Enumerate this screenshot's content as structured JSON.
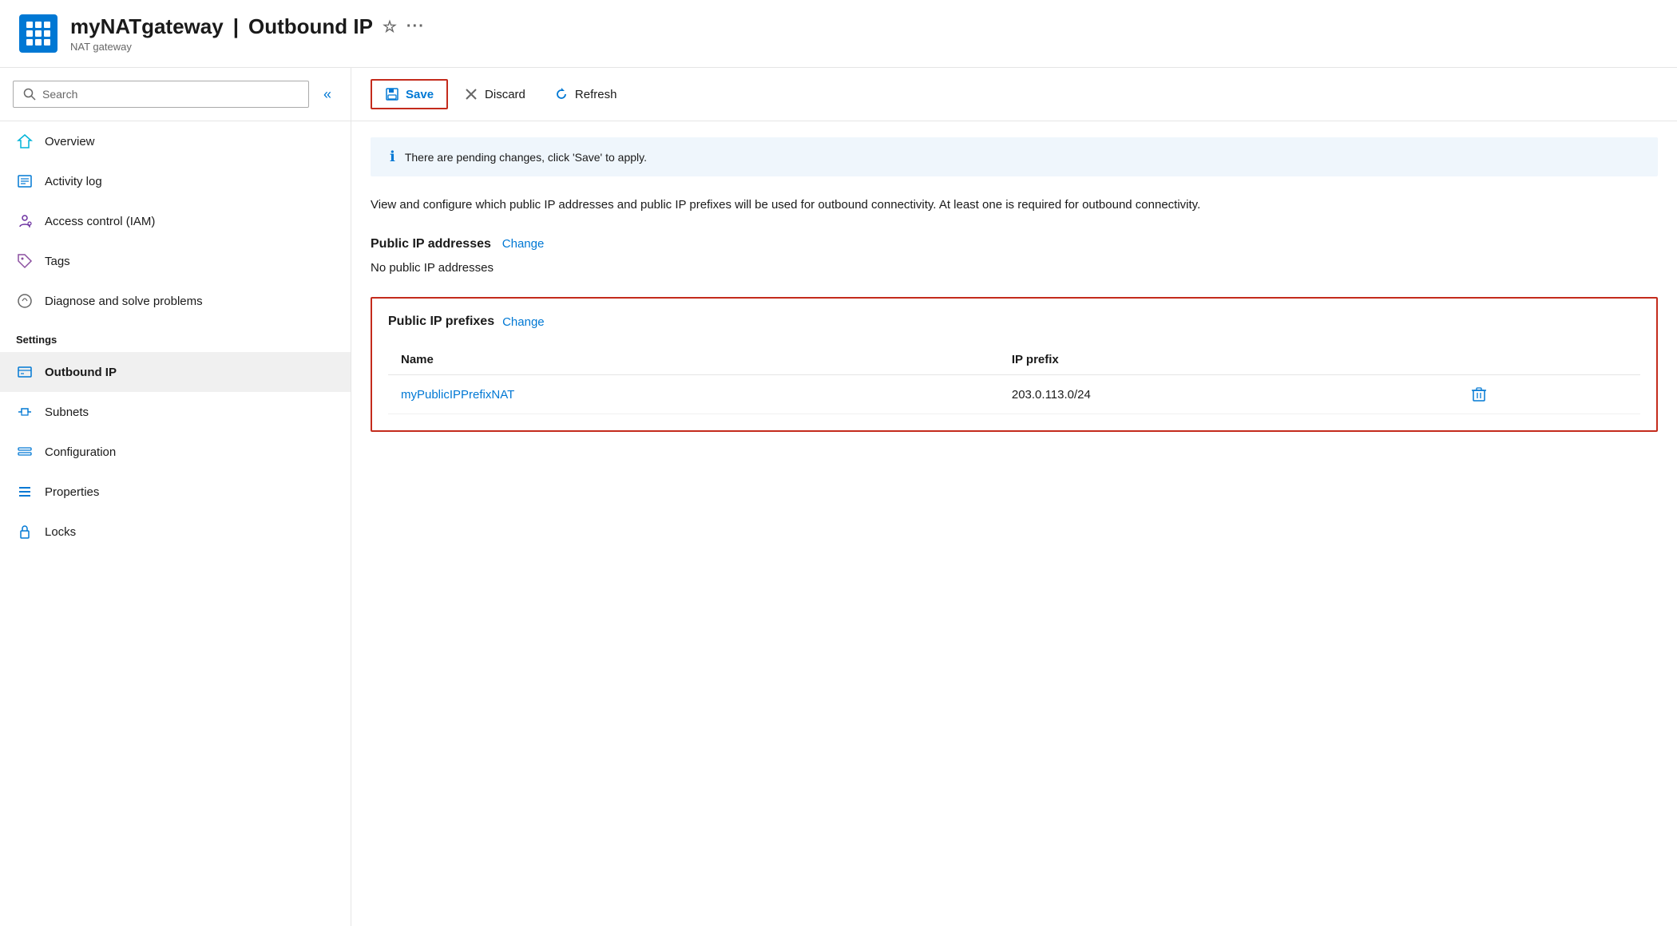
{
  "header": {
    "icon_label": "NAT gateway icon",
    "title_prefix": "myNATgateway",
    "title_separator": "|",
    "title_section": "Outbound IP",
    "subtitle": "NAT gateway"
  },
  "sidebar": {
    "search_placeholder": "Search",
    "collapse_label": "«",
    "nav_items": [
      {
        "id": "overview",
        "label": "Overview",
        "icon": "overview"
      },
      {
        "id": "activity-log",
        "label": "Activity log",
        "icon": "activity"
      },
      {
        "id": "access-control",
        "label": "Access control (IAM)",
        "icon": "iam"
      },
      {
        "id": "tags",
        "label": "Tags",
        "icon": "tags"
      },
      {
        "id": "diagnose",
        "label": "Diagnose and solve problems",
        "icon": "diagnose"
      }
    ],
    "settings_label": "Settings",
    "settings_items": [
      {
        "id": "outbound-ip",
        "label": "Outbound IP",
        "icon": "outbound",
        "active": true
      },
      {
        "id": "subnets",
        "label": "Subnets",
        "icon": "subnets"
      },
      {
        "id": "configuration",
        "label": "Configuration",
        "icon": "configuration"
      },
      {
        "id": "properties",
        "label": "Properties",
        "icon": "properties"
      },
      {
        "id": "locks",
        "label": "Locks",
        "icon": "locks"
      }
    ]
  },
  "toolbar": {
    "save_label": "Save",
    "discard_label": "Discard",
    "refresh_label": "Refresh"
  },
  "info_bar": {
    "message": "There are pending changes, click 'Save' to apply."
  },
  "content": {
    "description": "View and configure which public IP addresses and public IP prefixes will be used for outbound connectivity. At least one is required for outbound connectivity.",
    "public_ip_section": {
      "title": "Public IP addresses",
      "change_label": "Change",
      "no_items_label": "No public IP addresses"
    },
    "public_ip_prefixes_section": {
      "title": "Public IP prefixes",
      "change_label": "Change",
      "table_headers": [
        "Name",
        "IP prefix"
      ],
      "rows": [
        {
          "name": "myPublicIPPrefixNAT",
          "ip_prefix": "203.0.113.0/24"
        }
      ]
    }
  }
}
